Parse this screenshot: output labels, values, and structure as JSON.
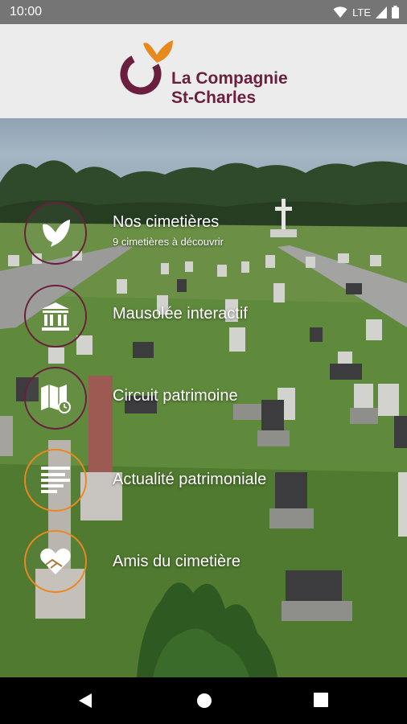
{
  "status_bar": {
    "time": "10:00",
    "network": "LTE"
  },
  "header": {
    "logo_line1": "La Compagnie",
    "logo_line2": "St-Charles",
    "colors": {
      "maroon": "#6b1f3f",
      "orange": "#e8891f"
    }
  },
  "menu": [
    {
      "label": "Nos cimetières",
      "subtitle": "9 cimetières à découvrir",
      "icon": "dove-icon",
      "ring": "maroon"
    },
    {
      "label": "Mausolée interactif",
      "icon": "mausoleum-icon",
      "ring": "maroon"
    },
    {
      "label": "Circuit patrimoine",
      "icon": "map-icon",
      "ring": "maroon"
    },
    {
      "label": "Actualité patrimoniale",
      "icon": "news-icon",
      "ring": "orange"
    },
    {
      "label": "Amis du cimetière",
      "icon": "heart-hand-icon",
      "ring": "orange"
    }
  ],
  "nav": {
    "back": "back-icon",
    "home": "home-icon",
    "recents": "recents-icon"
  }
}
